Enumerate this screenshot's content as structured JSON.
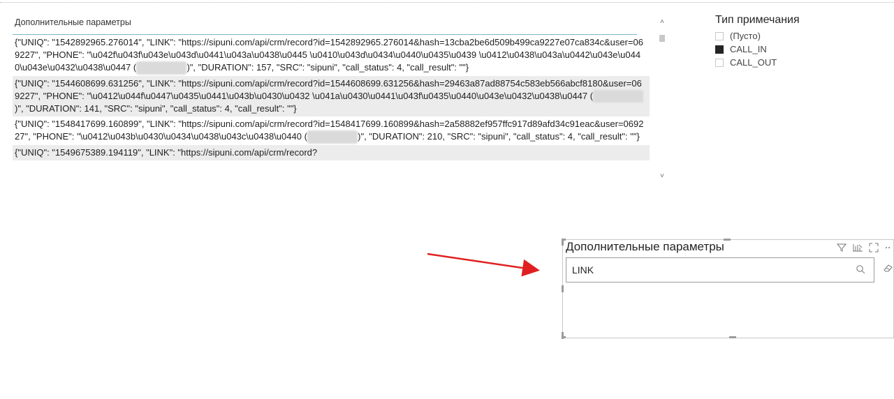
{
  "table": {
    "column_header": "Дополнительные параметры",
    "rows": [
      {
        "parts": [
          "{\"UNIQ\": \"1542892965.276014\", \"LINK\": \"https://sipuni.com/api/crm/record?id=1542892965.276014&hash=13cba2be6d509b499ca9227e07ca834c&user=069227\", \"PHONE\": \"\\u042f\\u043f\\u043e\\u043d\\u0441\\u043a\\u0438\\u0445 \\u0410\\u043d\\u0434\\u0440\\u0435\\u0439 \\u0412\\u0438\\u043a\\u0442\\u043e\\u0440\\u043e\\u0432\\u0438\\u0447 (",
          "7xxxxxxxxxx",
          ")\", \"DURATION\": 157, \"SRC\": \"sipuni\", \"call_status\": 4, \"call_result\": \"\"}"
        ]
      },
      {
        "parts": [
          "{\"UNIQ\": \"1544608699.631256\", \"LINK\": \"https://sipuni.com/api/crm/record?id=1544608699.631256&hash=29463a87ad88754c583eb566abcf8180&user=069227\", \"PHONE\": \"\\u0412\\u044f\\u0447\\u0435\\u0441\\u043b\\u0430\\u0432 \\u041a\\u0430\\u0441\\u043f\\u0435\\u0440\\u043e\\u0432\\u0438\\u0447 (",
          "7xxxxxxxxxx",
          ")\", \"DURATION\": 141, \"SRC\": \"sipuni\", \"call_status\": 4, \"call_result\": \"\"}"
        ]
      },
      {
        "parts": [
          "{\"UNIQ\": \"1548417699.160899\", \"LINK\": \"https://sipuni.com/api/crm/record?id=1548417699.160899&hash=2a58882ef957ffc917d89afd34c91eac&user=069227\", \"PHONE\": \"\\u0412\\u043b\\u0430\\u0434\\u0438\\u043c\\u0438\\u0440 (",
          "7xxxxxxxxxx",
          ")\", \"DURATION\": 210, \"SRC\": \"sipuni\", \"call_status\": 4, \"call_result\": \"\"}"
        ]
      },
      {
        "parts": [
          "{\"UNIQ\": \"1549675389.194119\", \"LINK\": \"https://sipuni.com/api/crm/record?",
          "",
          ""
        ]
      }
    ]
  },
  "slicer": {
    "title": "Тип примечания",
    "items": [
      {
        "label": "(Пусто)",
        "checked": false
      },
      {
        "label": "CALL_IN",
        "checked": true
      },
      {
        "label": "CALL_OUT",
        "checked": false
      }
    ]
  },
  "search_visual": {
    "title": "Дополнительные параметры",
    "search_value": "LINK"
  },
  "colors": {
    "arrow": "#e02020",
    "alt_row": "#ececec",
    "header_line": "#7fb6c9"
  },
  "icons": [
    "filter-icon",
    "focus-mode-icon",
    "expand-icon",
    "more-options-icon",
    "search-icon",
    "eraser-icon",
    "scroll-up-icon",
    "scroll-down-icon"
  ]
}
